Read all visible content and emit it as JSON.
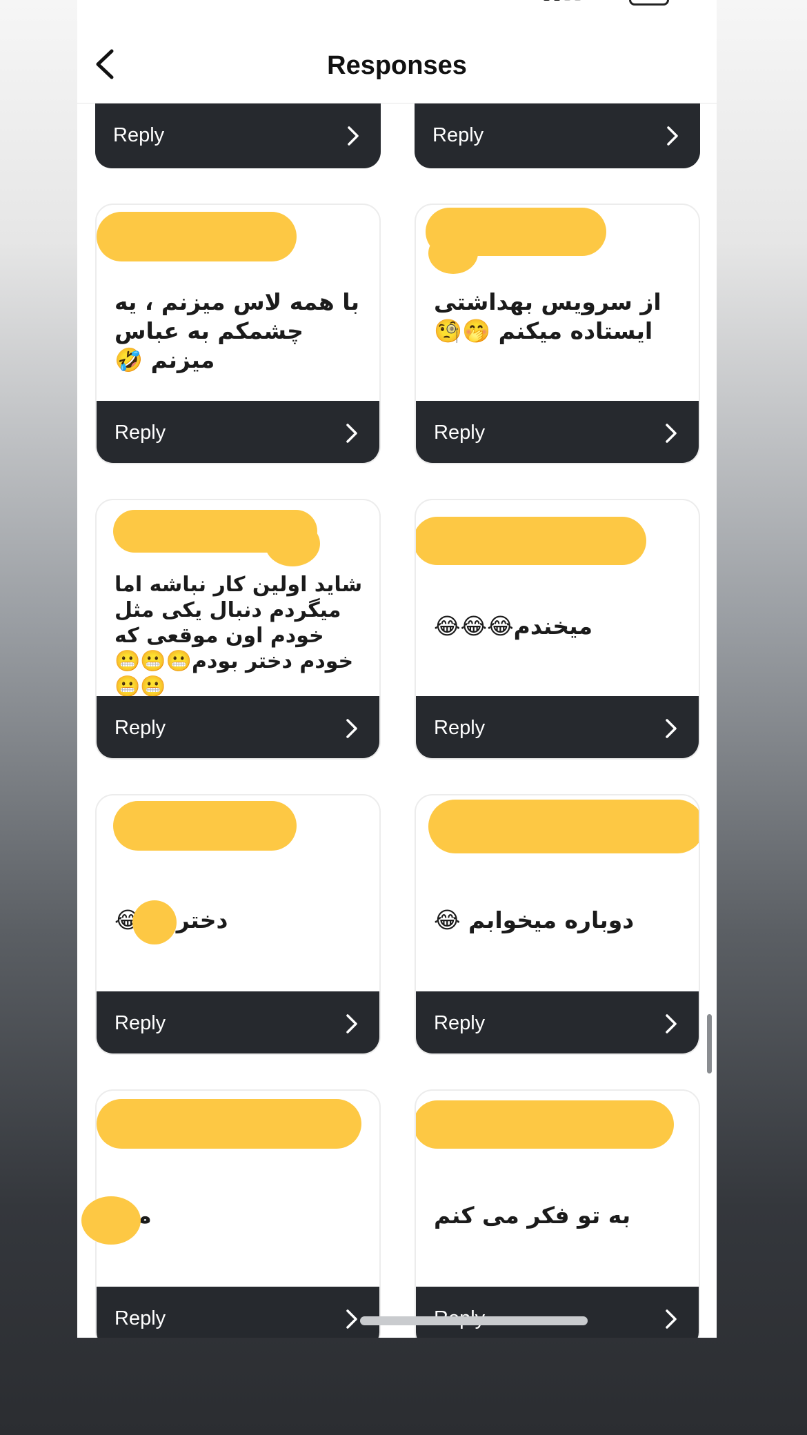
{
  "header": {
    "title": "Responses",
    "back_icon": "chevron-left-icon"
  },
  "colors": {
    "card_footer": "#26292e",
    "redaction": "#fdc844",
    "background_top": "#f6f6f6",
    "background_bottom": "#2b2d31"
  },
  "reply_label": "Reply",
  "top_row": [
    {
      "reply": "Reply"
    },
    {
      "reply": "Reply"
    }
  ],
  "cards": [
    {
      "message": "با همه لاس میزنم ، یه چشمکم به عباس میزنم 🤣",
      "reply": "Reply"
    },
    {
      "message": "از سرویس بهداشتی ایستاده میکنم 🤭🧐",
      "reply": "Reply"
    },
    {
      "message": "شاید اولین کار نباشه اما میگردم دنبال  یکی مثل خودم اون موقعی که  خودم دختر بودم😬😬😬😬😬",
      "reply": "Reply"
    },
    {
      "message": "میخندم😂😂😂",
      "reply": "Reply"
    },
    {
      "message": "دختر کر😂",
      "reply": "Reply"
    },
    {
      "message": "دوباره میخوابم 😂",
      "reply": "Reply"
    },
    {
      "message": "می",
      "reply": "Reply"
    },
    {
      "message": "به تو فکر می کنم",
      "reply": "Reply"
    }
  ]
}
